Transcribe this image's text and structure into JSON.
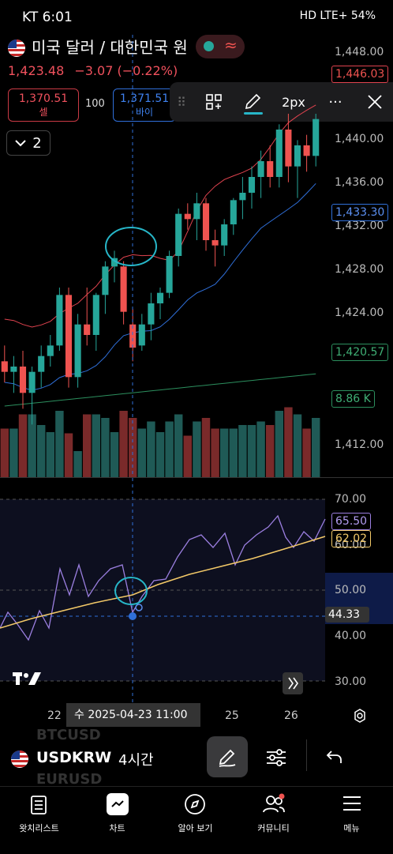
{
  "status": {
    "carrier_time": "KT 6:01",
    "right": "HD LTE+ 54%"
  },
  "header": {
    "title": "미국 달러 / 대한민국 원",
    "last_price": "1,423.48",
    "change": "−3.07 (−0.22%)",
    "sell_price": "1,370.51",
    "sell_label": "셀",
    "spread": "100",
    "buy_price": "1,371.51",
    "buy_label": "바이",
    "indicator_count": "2"
  },
  "drawing_toolbar": {
    "width_label": "2px",
    "more": "···"
  },
  "price_axis": {
    "ticks": [
      "1,448.00",
      "1,440.00",
      "1,436.00",
      "1,432.00",
      "1,428.00",
      "1,424.00",
      "1,412.00"
    ],
    "tag_last": "1,446.03",
    "tag_ma_blue": "1,433.30",
    "tag_ma_green": "1,420.57",
    "tag_volume": "8.86 K"
  },
  "rsi_axis": {
    "ticks": [
      "70.00",
      "60.00",
      "50.00",
      "40.00",
      "30.00"
    ],
    "tag_rsi": "65.50",
    "tag_ma": "62.02",
    "tag_cursor": "44.33"
  },
  "time_axis": {
    "day22": "22",
    "cursor_label": "수 2025-04-23   11:00",
    "day25": "25",
    "day26": "26"
  },
  "symbol_bar": {
    "symbol": "USDKRW",
    "interval": "4시간",
    "ghost_above": "BTCUSD",
    "ghost_below": "EURUSD"
  },
  "nav": {
    "watchlist": "왓치리스트",
    "chart": "차트",
    "explore": "알아 보기",
    "community": "커뮤니티",
    "menu": "메뉴"
  },
  "colors": {
    "up": "#26a69a",
    "down": "#ef5350",
    "ma_blue": "#2f6fd9",
    "ma_red": "#e0434f",
    "ma_green": "#2c8f5e",
    "rsi": "#9b7fe0",
    "rsi_ma": "#f3c968",
    "annotation": "#27b6c8"
  },
  "chart_data": {
    "type": "candlestick",
    "ylim": [
      1410,
      1449
    ],
    "candles": [
      {
        "o": 1419.5,
        "h": 1421.0,
        "l": 1417.5,
        "c": 1418.5
      },
      {
        "o": 1418.5,
        "h": 1420.0,
        "l": 1416.5,
        "c": 1419.0
      },
      {
        "o": 1419.0,
        "h": 1420.5,
        "l": 1415.0,
        "c": 1416.5
      },
      {
        "o": 1416.5,
        "h": 1419.0,
        "l": 1413.5,
        "c": 1418.5
      },
      {
        "o": 1418.5,
        "h": 1421.0,
        "l": 1417.0,
        "c": 1420.0
      },
      {
        "o": 1420.0,
        "h": 1422.0,
        "l": 1419.0,
        "c": 1421.0
      },
      {
        "o": 1421.0,
        "h": 1426.5,
        "l": 1420.5,
        "c": 1425.8
      },
      {
        "o": 1425.8,
        "h": 1426.5,
        "l": 1417.0,
        "c": 1418.0
      },
      {
        "o": 1418.0,
        "h": 1424.0,
        "l": 1417.0,
        "c": 1423.0
      },
      {
        "o": 1423.0,
        "h": 1426.5,
        "l": 1421.0,
        "c": 1422.0
      },
      {
        "o": 1422.0,
        "h": 1426.0,
        "l": 1420.5,
        "c": 1425.8
      },
      {
        "o": 1425.8,
        "h": 1429.0,
        "l": 1424.0,
        "c": 1428.5
      },
      {
        "o": 1428.5,
        "h": 1430.0,
        "l": 1427.0,
        "c": 1429.3
      },
      {
        "o": 1428.5,
        "h": 1429.0,
        "l": 1423.0,
        "c": 1424.2
      },
      {
        "o": 1423.0,
        "h": 1424.5,
        "l": 1419.5,
        "c": 1420.8
      },
      {
        "o": 1421.0,
        "h": 1424.0,
        "l": 1420.5,
        "c": 1423.0
      },
      {
        "o": 1423.0,
        "h": 1426.0,
        "l": 1421.5,
        "c": 1425.0
      },
      {
        "o": 1425.0,
        "h": 1426.5,
        "l": 1423.5,
        "c": 1426.0
      },
      {
        "o": 1426.0,
        "h": 1430.0,
        "l": 1425.5,
        "c": 1429.5
      },
      {
        "o": 1429.5,
        "h": 1434.0,
        "l": 1428.5,
        "c": 1433.5
      },
      {
        "o": 1433.5,
        "h": 1434.5,
        "l": 1432.0,
        "c": 1433.0
      },
      {
        "o": 1433.0,
        "h": 1435.5,
        "l": 1431.0,
        "c": 1434.5
      },
      {
        "o": 1434.5,
        "h": 1435.0,
        "l": 1430.0,
        "c": 1431.0
      },
      {
        "o": 1431.0,
        "h": 1432.0,
        "l": 1428.5,
        "c": 1430.5
      },
      {
        "o": 1430.5,
        "h": 1433.0,
        "l": 1429.5,
        "c": 1432.5
      },
      {
        "o": 1432.5,
        "h": 1435.0,
        "l": 1431.5,
        "c": 1434.8
      },
      {
        "o": 1434.8,
        "h": 1437.0,
        "l": 1433.0,
        "c": 1435.5
      },
      {
        "o": 1435.5,
        "h": 1438.0,
        "l": 1434.0,
        "c": 1437.0
      },
      {
        "o": 1437.0,
        "h": 1439.5,
        "l": 1435.0,
        "c": 1438.5
      },
      {
        "o": 1438.5,
        "h": 1440.0,
        "l": 1436.0,
        "c": 1437.0
      },
      {
        "o": 1437.0,
        "h": 1442.0,
        "l": 1436.0,
        "c": 1441.5
      },
      {
        "o": 1441.5,
        "h": 1443.0,
        "l": 1436.5,
        "c": 1438.0
      },
      {
        "o": 1438.0,
        "h": 1440.5,
        "l": 1435.0,
        "c": 1440.0
      },
      {
        "o": 1440.0,
        "h": 1441.0,
        "l": 1437.5,
        "c": 1439.0
      },
      {
        "o": 1439.0,
        "h": 1443.0,
        "l": 1438.0,
        "c": 1442.5
      }
    ]
  }
}
